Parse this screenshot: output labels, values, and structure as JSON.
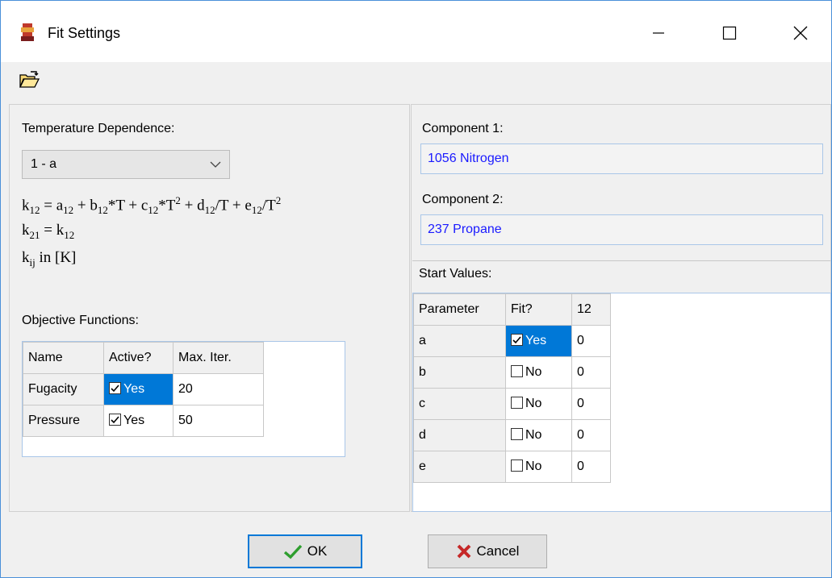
{
  "window": {
    "title": "Fit Settings"
  },
  "left": {
    "temp_dep_label": "Temperature Dependence:",
    "temp_dep_value": "1 - a",
    "formula_k12": "k12 = a12 + b12*T + c12*T2 + d12/T + e12/T2",
    "formula_k21": "k21 = k12",
    "formula_unit": "kij in [K]",
    "objective_label": "Objective Functions:",
    "objective": {
      "headers": [
        "Name",
        "Active?",
        "Max. Iter."
      ],
      "rows": [
        {
          "name": "Fugacity",
          "active": "Yes",
          "max_iter": "20"
        },
        {
          "name": "Pressure",
          "active": "Yes",
          "max_iter": "50"
        }
      ]
    }
  },
  "right": {
    "comp1_label": "Component 1:",
    "comp1_value": "1056 Nitrogen",
    "comp2_label": "Component 2:",
    "comp2_value": "237 Propane",
    "start_label": "Start Values:",
    "start": {
      "headers": [
        "Parameter",
        "Fit?",
        "12"
      ],
      "rows": [
        {
          "param": "a",
          "fit": "Yes",
          "value": "0"
        },
        {
          "param": "b",
          "fit": "No",
          "value": "0"
        },
        {
          "param": "c",
          "fit": "No",
          "value": "0"
        },
        {
          "param": "d",
          "fit": "No",
          "value": "0"
        },
        {
          "param": "e",
          "fit": "No",
          "value": "0"
        }
      ]
    }
  },
  "buttons": {
    "ok": "OK",
    "cancel": "Cancel"
  }
}
